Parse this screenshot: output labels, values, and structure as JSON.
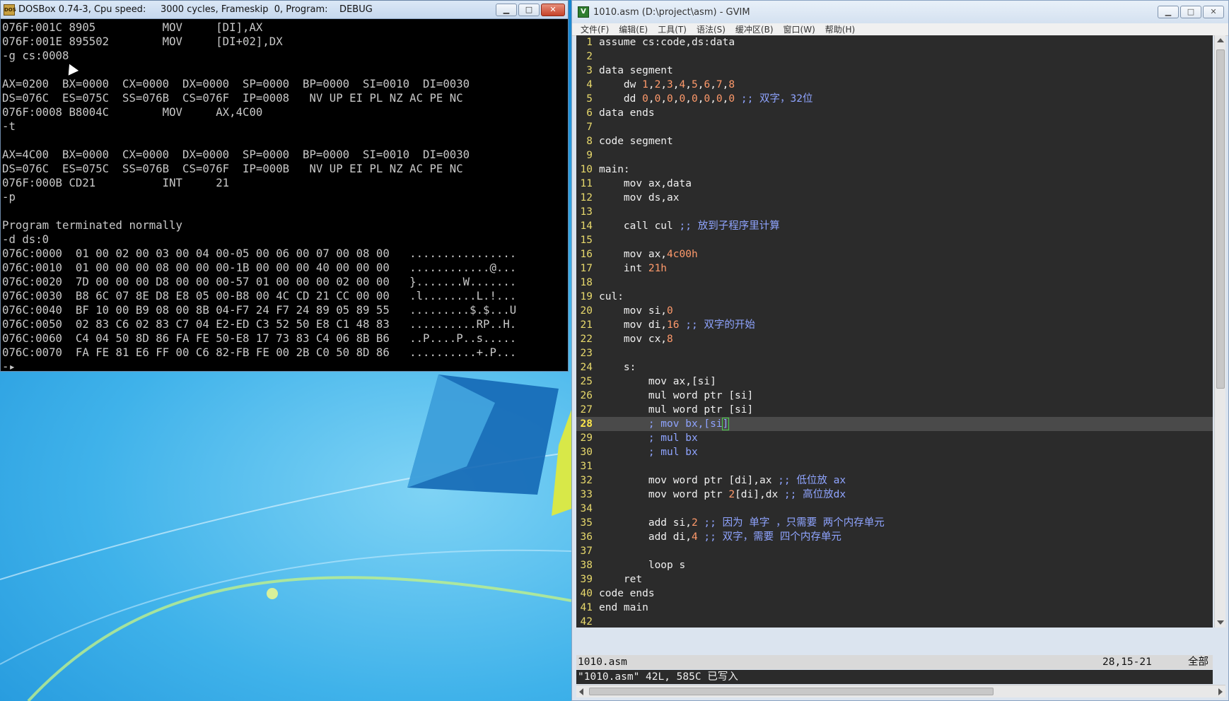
{
  "dosbox": {
    "icon": "dosbox-icon",
    "title": "DOSBox 0.74-3, Cpu speed:     3000 cycles, Frameskip  0, Program:    DEBUG",
    "lines": [
      "076F:001C 8905          MOV     [DI],AX",
      "076F:001E 895502        MOV     [DI+02],DX",
      "-g cs:0008",
      "",
      "AX=0200  BX=0000  CX=0000  DX=0000  SP=0000  BP=0000  SI=0010  DI=0030",
      "DS=076C  ES=075C  SS=076B  CS=076F  IP=0008   NV UP EI PL NZ AC PE NC",
      "076F:0008 B8004C        MOV     AX,4C00",
      "-t",
      "",
      "AX=4C00  BX=0000  CX=0000  DX=0000  SP=0000  BP=0000  SI=0010  DI=0030",
      "DS=076C  ES=075C  SS=076B  CS=076F  IP=000B   NV UP EI PL NZ AC PE NC",
      "076F:000B CD21          INT     21",
      "-p",
      "",
      "Program terminated normally",
      "-d ds:0",
      "076C:0000  01 00 02 00 03 00 04 00-05 00 06 00 07 00 08 00   ................",
      "076C:0010  01 00 00 00 08 00 00 00-1B 00 00 00 40 00 00 00   ............@...",
      "076C:0020  7D 00 00 00 D8 00 00 00-57 01 00 00 00 02 00 00   }.......W.......",
      "076C:0030  B8 6C 07 8E D8 E8 05 00-B8 00 4C CD 21 CC 00 00   .l........L.!...",
      "076C:0040  BF 10 00 B9 08 00 8B 04-F7 24 F7 24 89 05 89 55   .........$.$...U",
      "076C:0050  02 83 C6 02 83 C7 04 E2-ED C3 52 50 E8 C1 48 83   ..........RP..H.",
      "076C:0060  C4 04 50 8D 86 FA FE 50-E8 17 73 83 C4 06 8B B6   ..P....P..s.....",
      "076C:0070  FA FE 81 E6 FF 00 C6 82-FB FE 00 2B C0 50 8D 86   ..........+.P...",
      "-▸"
    ]
  },
  "gvim": {
    "icon": "gvim-icon",
    "title": "1010.asm (D:\\project\\asm) - GVIM",
    "menu": [
      "文件(F)",
      "编辑(E)",
      "工具(T)",
      "语法(S)",
      "缓冲区(B)",
      "窗口(W)",
      "帮助(H)"
    ],
    "code": [
      {
        "n": "1",
        "t": [
          [
            "assume cs:code,ds:data",
            ""
          ]
        ]
      },
      {
        "n": "2",
        "t": [
          [
            "",
            ""
          ]
        ]
      },
      {
        "n": "3",
        "t": [
          [
            "data segment",
            ""
          ]
        ]
      },
      {
        "n": "4",
        "t": [
          [
            "    dw ",
            ""
          ],
          [
            "1",
            "num"
          ],
          [
            ",",
            ""
          ],
          [
            "2",
            "num"
          ],
          [
            ",",
            ""
          ],
          [
            "3",
            "num"
          ],
          [
            ",",
            ""
          ],
          [
            "4",
            "num"
          ],
          [
            ",",
            ""
          ],
          [
            "5",
            "num"
          ],
          [
            ",",
            ""
          ],
          [
            "6",
            "num"
          ],
          [
            ",",
            ""
          ],
          [
            "7",
            "num"
          ],
          [
            ",",
            ""
          ],
          [
            "8",
            "num"
          ]
        ]
      },
      {
        "n": "5",
        "t": [
          [
            "    dd ",
            ""
          ],
          [
            "0",
            "num"
          ],
          [
            ",",
            ""
          ],
          [
            "0",
            "num"
          ],
          [
            ",",
            ""
          ],
          [
            "0",
            "num"
          ],
          [
            ",",
            ""
          ],
          [
            "0",
            "num"
          ],
          [
            ",",
            ""
          ],
          [
            "0",
            "num"
          ],
          [
            ",",
            ""
          ],
          [
            "0",
            "num"
          ],
          [
            ",",
            ""
          ],
          [
            "0",
            "num"
          ],
          [
            ",",
            ""
          ],
          [
            "0",
            "num"
          ],
          [
            " ;; 双字，32位",
            "cmt"
          ]
        ]
      },
      {
        "n": "6",
        "t": [
          [
            "data ends",
            ""
          ]
        ]
      },
      {
        "n": "7",
        "t": [
          [
            "",
            ""
          ]
        ]
      },
      {
        "n": "8",
        "t": [
          [
            "code segment",
            ""
          ]
        ]
      },
      {
        "n": "9",
        "t": [
          [
            "",
            ""
          ]
        ]
      },
      {
        "n": "10",
        "t": [
          [
            "main:",
            ""
          ]
        ]
      },
      {
        "n": "11",
        "t": [
          [
            "    mov ax,data",
            ""
          ]
        ]
      },
      {
        "n": "12",
        "t": [
          [
            "    mov ds,ax",
            ""
          ]
        ]
      },
      {
        "n": "13",
        "t": [
          [
            "",
            ""
          ]
        ]
      },
      {
        "n": "14",
        "t": [
          [
            "    call cul ",
            ""
          ],
          [
            ";; 放到子程序里计算",
            "cmt"
          ]
        ]
      },
      {
        "n": "15",
        "t": [
          [
            "",
            ""
          ]
        ]
      },
      {
        "n": "16",
        "t": [
          [
            "    mov ax,",
            ""
          ],
          [
            "4c00h",
            "num"
          ]
        ]
      },
      {
        "n": "17",
        "t": [
          [
            "    int ",
            ""
          ],
          [
            "21h",
            "num"
          ]
        ]
      },
      {
        "n": "18",
        "t": [
          [
            "",
            ""
          ]
        ]
      },
      {
        "n": "19",
        "t": [
          [
            "cul:",
            ""
          ]
        ]
      },
      {
        "n": "20",
        "t": [
          [
            "    mov si,",
            ""
          ],
          [
            "0",
            "num"
          ]
        ]
      },
      {
        "n": "21",
        "t": [
          [
            "    mov di,",
            ""
          ],
          [
            "16",
            "num"
          ],
          [
            " ;; 双字的开始",
            "cmt"
          ]
        ]
      },
      {
        "n": "22",
        "t": [
          [
            "    mov cx,",
            ""
          ],
          [
            "8",
            "num"
          ]
        ]
      },
      {
        "n": "23",
        "t": [
          [
            "",
            ""
          ]
        ]
      },
      {
        "n": "24",
        "t": [
          [
            "    s:",
            ""
          ]
        ]
      },
      {
        "n": "25",
        "t": [
          [
            "        mov ax,[si]",
            ""
          ]
        ]
      },
      {
        "n": "26",
        "t": [
          [
            "        mul word ptr [si]",
            ""
          ]
        ]
      },
      {
        "n": "27",
        "t": [
          [
            "        mul word ptr [si]",
            ""
          ]
        ]
      },
      {
        "n": "28",
        "t": [
          [
            "        ; mov bx,[si",
            "cmt"
          ],
          [
            "]",
            "cmt hl"
          ]
        ],
        "current": true
      },
      {
        "n": "29",
        "t": [
          [
            "        ; mul bx",
            "cmt"
          ]
        ]
      },
      {
        "n": "30",
        "t": [
          [
            "        ; mul bx",
            "cmt"
          ]
        ]
      },
      {
        "n": "31",
        "t": [
          [
            "",
            ""
          ]
        ]
      },
      {
        "n": "32",
        "t": [
          [
            "        mov word ptr [di],ax ",
            ""
          ],
          [
            ";; 低位放 ax",
            "cmt"
          ]
        ]
      },
      {
        "n": "33",
        "t": [
          [
            "        mov word ptr ",
            ""
          ],
          [
            "2",
            "num"
          ],
          [
            "[di],dx ",
            ""
          ],
          [
            ";; 高位放dx",
            "cmt"
          ]
        ]
      },
      {
        "n": "34",
        "t": [
          [
            "",
            ""
          ]
        ]
      },
      {
        "n": "35",
        "t": [
          [
            "        add si,",
            ""
          ],
          [
            "2",
            "num"
          ],
          [
            " ;; 因为 单字 ，只需要 两个内存单元",
            "cmt"
          ]
        ]
      },
      {
        "n": "36",
        "t": [
          [
            "        add di,",
            ""
          ],
          [
            "4",
            "num"
          ],
          [
            " ;; 双字，需要 四个内存单元",
            "cmt"
          ]
        ]
      },
      {
        "n": "37",
        "t": [
          [
            "",
            ""
          ]
        ]
      },
      {
        "n": "38",
        "t": [
          [
            "        loop s",
            ""
          ]
        ]
      },
      {
        "n": "39",
        "t": [
          [
            "    ret",
            ""
          ]
        ]
      },
      {
        "n": "40",
        "t": [
          [
            "code ends",
            ""
          ]
        ]
      },
      {
        "n": "41",
        "t": [
          [
            "end main",
            ""
          ]
        ]
      },
      {
        "n": "42",
        "t": [
          [
            "",
            ""
          ]
        ]
      }
    ],
    "tildes": [
      "~",
      "~"
    ],
    "status": {
      "file": "1010.asm",
      "position": "28,15-21",
      "scroll": "全部"
    },
    "cmdline": "\"1010.asm\" 42L, 585C 已写入"
  },
  "colors": {
    "dos_text": "#c8c8c8",
    "vim_bg": "#2b2b2b",
    "vim_linenr": "#e8d96c",
    "vim_number": "#ff9a6b",
    "vim_comment": "#8fa4ff"
  }
}
